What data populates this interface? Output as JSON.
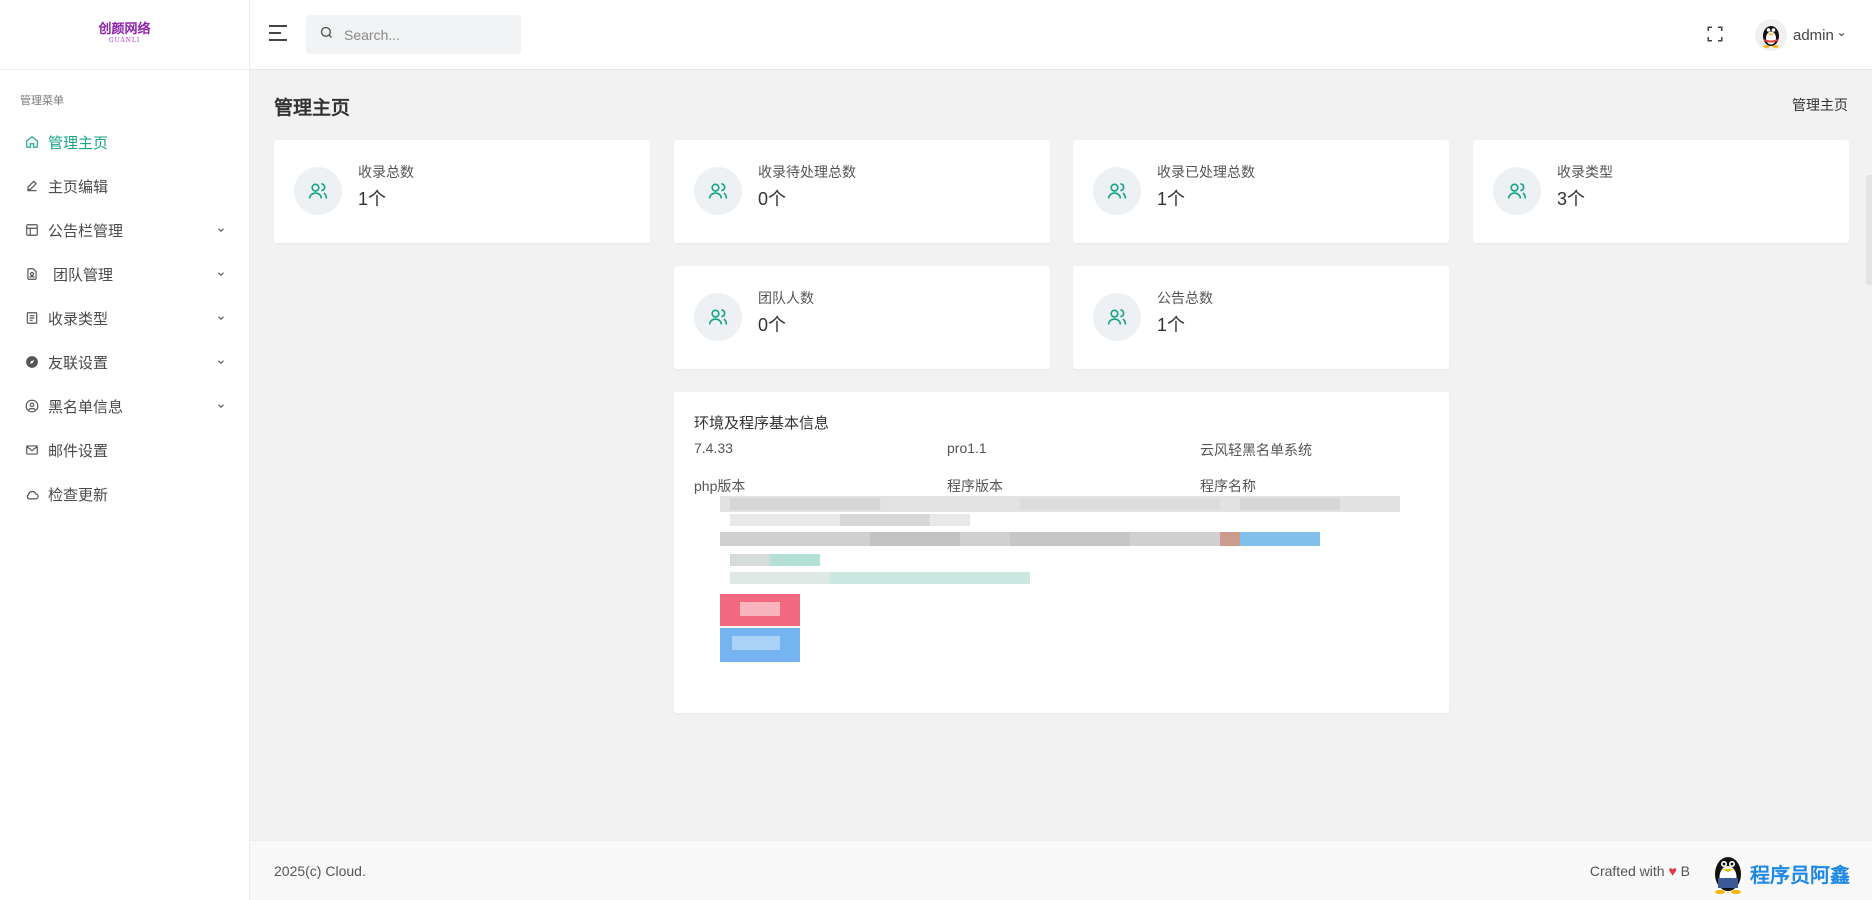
{
  "brand": {
    "logo_text": "创颜网络",
    "logo_sub": "GUANLI"
  },
  "sidebar": {
    "caption": "管理菜单",
    "items": [
      {
        "label": "管理主页",
        "icon": "home-icon",
        "active": true,
        "has_children": false
      },
      {
        "label": "主页编辑",
        "icon": "pencil-icon",
        "active": false,
        "has_children": false
      },
      {
        "label": "公告栏管理",
        "icon": "layout-icon",
        "active": false,
        "has_children": true
      },
      {
        "label": "团队管理",
        "icon": "contact-file-icon",
        "active": false,
        "has_children": true
      },
      {
        "label": "收录类型",
        "icon": "list-doc-icon",
        "active": false,
        "has_children": true
      },
      {
        "label": "友联设置",
        "icon": "compass-icon",
        "active": false,
        "has_children": true
      },
      {
        "label": "黑名单信息",
        "icon": "user-circle-icon",
        "active": false,
        "has_children": true
      },
      {
        "label": "邮件设置",
        "icon": "mail-icon",
        "active": false,
        "has_children": false
      },
      {
        "label": "检查更新",
        "icon": "cloud-icon",
        "active": false,
        "has_children": false
      }
    ]
  },
  "header": {
    "search_placeholder": "Search...",
    "user_name": "admin"
  },
  "page": {
    "title": "管理主页",
    "breadcrumb": "管理主页"
  },
  "stats": [
    {
      "label": "收录总数",
      "value": "1个"
    },
    {
      "label": "收录待处理总数",
      "value": "0个"
    },
    {
      "label": "收录已处理总数",
      "value": "1个"
    },
    {
      "label": "收录类型",
      "value": "3个"
    },
    {
      "label": "团队人数",
      "value": "0个"
    },
    {
      "label": "公告总数",
      "value": "1个"
    }
  ],
  "info": {
    "title": "环境及程序基本信息",
    "columns": [
      {
        "value": "7.4.33",
        "key": "php版本"
      },
      {
        "value": "pro1.1",
        "key": "程序版本"
      },
      {
        "value": "云风轻黑名单系统",
        "key": "程序名称"
      }
    ]
  },
  "footer": {
    "copyright": "2025(c) Cloud.",
    "crafted_prefix": "Crafted with",
    "crafted_heart": "♥",
    "crafted_suffix": "B"
  },
  "watermark": {
    "text": "程序员阿鑫"
  },
  "colors": {
    "accent": "#17a589",
    "background": "#f2f2f2"
  }
}
